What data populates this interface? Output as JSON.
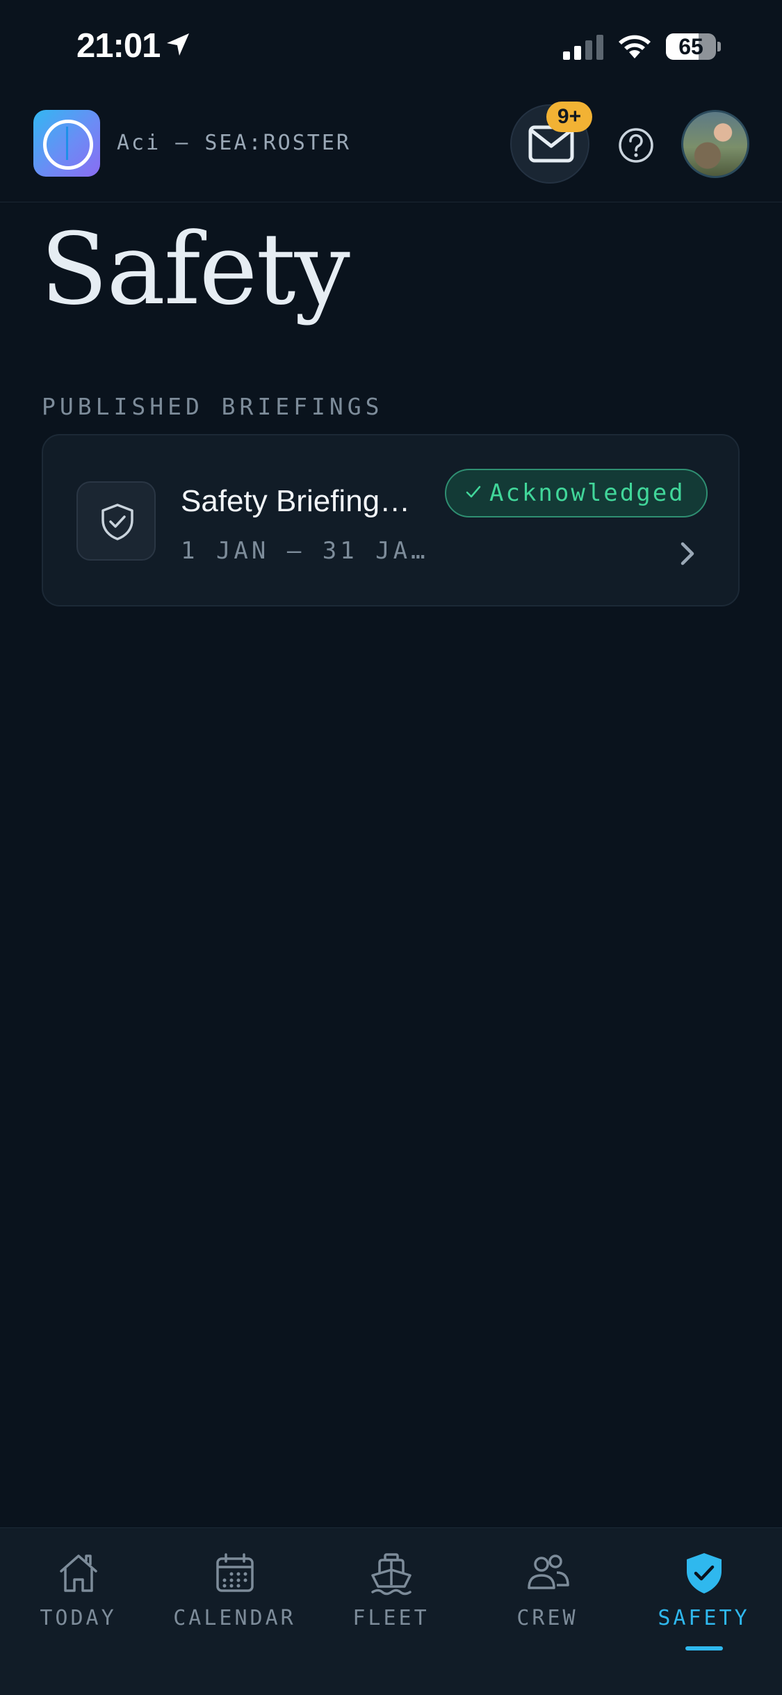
{
  "status_bar": {
    "time": "21:01",
    "battery_level": "65",
    "icons": [
      "location-arrow-icon",
      "signal-icon",
      "wifi-icon",
      "battery-icon"
    ]
  },
  "header": {
    "app_name": "Aci – SEA:ROSTER",
    "mail_badge": "9+",
    "icons": [
      "app-logo",
      "mail-icon",
      "help-icon",
      "avatar"
    ],
    "colors": {
      "badge": "#f2b234",
      "accent": "#2fb8ee"
    }
  },
  "page": {
    "title": "Safety",
    "section_label": "PUBLISHED BRIEFINGS"
  },
  "briefings": [
    {
      "title": "Safety Briefing…",
      "dates": "1 JAN – 31 JA…",
      "status": "Acknowledged",
      "status_color": "#41d69a",
      "icon": "shield-check-icon"
    }
  ],
  "tabs": [
    {
      "label": "TODAY",
      "icon": "home-icon",
      "active": false
    },
    {
      "label": "CALENDAR",
      "icon": "calendar-icon",
      "active": false
    },
    {
      "label": "FLEET",
      "icon": "ship-icon",
      "active": false
    },
    {
      "label": "CREW",
      "icon": "people-icon",
      "active": false
    },
    {
      "label": "SAFETY",
      "icon": "shield-check-icon",
      "active": true
    }
  ]
}
